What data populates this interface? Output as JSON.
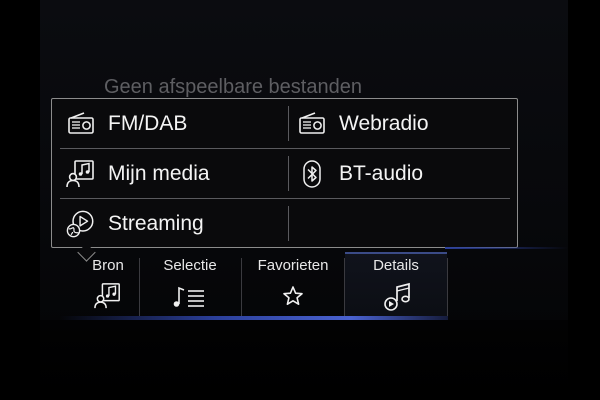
{
  "background_message": "Geen afspeelbare bestanden",
  "source_menu": {
    "items": [
      {
        "label": "FM/DAB",
        "icon": "radio-icon"
      },
      {
        "label": "Webradio",
        "icon": "radio-icon"
      },
      {
        "label": "Mijn media",
        "icon": "media-user-icon"
      },
      {
        "label": "BT-audio",
        "icon": "bluetooth-icon"
      },
      {
        "label": "Streaming",
        "icon": "streaming-icon"
      }
    ]
  },
  "tabs": [
    {
      "label": "Bron",
      "icon": "media-user-icon"
    },
    {
      "label": "Selectie",
      "icon": "playlist-icon"
    },
    {
      "label": "Favorieten",
      "icon": "star-icon"
    },
    {
      "label": "Details",
      "icon": "music-note-icon",
      "active": true
    }
  ],
  "colors": {
    "background": "#000000",
    "popup_border": "#8c8c8c",
    "accent_blue": "#3b4b87",
    "text": "#f2f2f2",
    "dim_text": "#5e5e62"
  }
}
